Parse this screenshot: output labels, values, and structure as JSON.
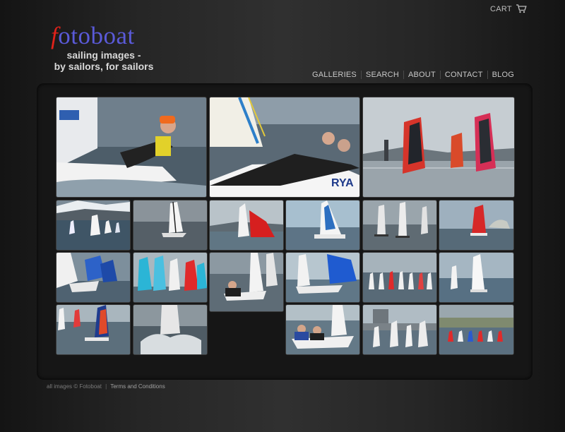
{
  "header": {
    "cart_label": "CART",
    "logo_first_letter": "f",
    "logo_rest": "otoboat",
    "tagline_line1": "sailing images -",
    "tagline_line2": "by sailors, for sailors"
  },
  "nav": {
    "items": [
      "GALLERIES",
      "SEARCH",
      "ABOUT",
      "CONTACT",
      "BLOG"
    ]
  },
  "gallery": {
    "thumbnails": [
      {
        "scene": "laser-sailor-orange-hat"
      },
      {
        "scene": "dinghy-crew-rya"
      },
      {
        "scene": "windsurfers-red-sails"
      },
      {
        "scene": "dinghy-fleet-mountains"
      },
      {
        "scene": "dinghy-grey-sea"
      },
      {
        "scene": "red-gennaker-dinghy"
      },
      {
        "scene": "dinghy-blue-sky"
      },
      {
        "scene": "catamarans-fleet"
      },
      {
        "scene": "red-sail-rock-island"
      },
      {
        "scene": "blue-spinnakers-start"
      },
      {
        "scene": "colourful-sails-fleet"
      },
      {
        "scene": "dinghy-sailor-waves"
      },
      {
        "scene": "dinghy-blue-spinnaker"
      },
      {
        "scene": "optimist-line"
      },
      {
        "scene": "single-dinghies-sea"
      },
      {
        "scene": "youth-dinghies-red"
      },
      {
        "scene": "catamaran-spray"
      },
      {
        "scene": "crew-white-dinghy"
      },
      {
        "scene": "castle-fleet"
      },
      {
        "scene": "harbour-fleet"
      }
    ]
  },
  "footer": {
    "copyright": "all images © Fotoboat",
    "separator": "|",
    "terms_label": "Terms and Conditions"
  },
  "colors": {
    "logo_blue": "#5a5ad8",
    "logo_red": "#e0221a",
    "background": "#2a2a2a",
    "panel": "#161616"
  }
}
